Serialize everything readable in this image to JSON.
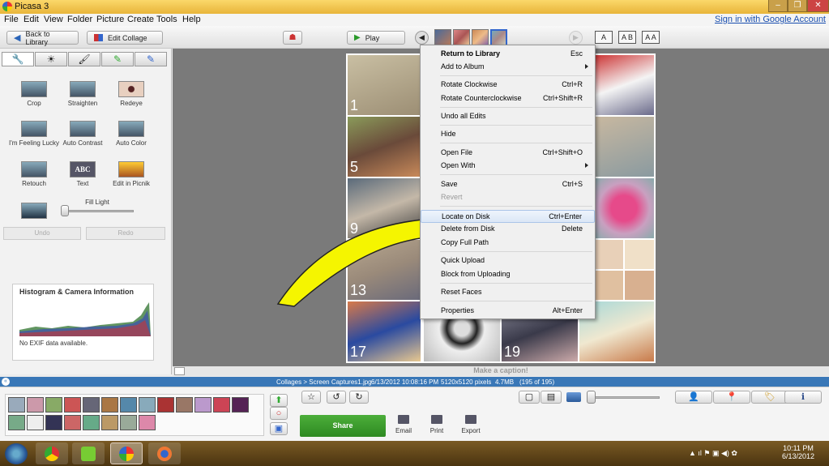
{
  "window": {
    "title": "Picasa 3"
  },
  "menu": {
    "items": [
      "File",
      "Edit",
      "View",
      "Folder",
      "Picture",
      "Create",
      "Tools",
      "Help"
    ],
    "signin": "Sign in with Google Account"
  },
  "toolbar": {
    "back_label": "Back to Library",
    "edit_collage_label": "Edit Collage",
    "play_label": "Play",
    "text_sizes": [
      "A",
      "A B",
      "A A"
    ]
  },
  "left_panel": {
    "tools": [
      {
        "label": "Crop"
      },
      {
        "label": "Straighten"
      },
      {
        "label": "Redeye"
      },
      {
        "label": "I'm Feeling Lucky"
      },
      {
        "label": "Auto Contrast"
      },
      {
        "label": "Auto Color"
      },
      {
        "label": "Retouch"
      },
      {
        "label": "Text"
      },
      {
        "label": "Edit in Picnik"
      }
    ],
    "fill_light_label": "Fill Light",
    "undo_label": "Undo",
    "redo_label": "Redo",
    "histogram_title": "Histogram & Camera Information",
    "exif_text": "No EXIF data available."
  },
  "collage": {
    "numbers": [
      "1",
      "5",
      "9",
      "13",
      "17",
      "19"
    ]
  },
  "caption": {
    "placeholder": "Make a caption!"
  },
  "status": {
    "path": "Collages > Screen Captures1.jpg",
    "datetime": "6/13/2012 10:08:16 PM",
    "dimensions": "5120x5120 pixels",
    "size": "4.7MB",
    "count": "(195 of 195)"
  },
  "context_menu": {
    "items": [
      {
        "label": "Return to Library",
        "accel": "Esc"
      },
      {
        "label": "Add to Album",
        "accel": ""
      },
      {
        "label": "Rotate Clockwise",
        "accel": "Ctrl+R"
      },
      {
        "label": "Rotate Counterclockwise",
        "accel": "Ctrl+Shift+R"
      },
      {
        "label": "Undo all Edits",
        "accel": ""
      },
      {
        "label": "Hide",
        "accel": ""
      },
      {
        "label": "Open File",
        "accel": "Ctrl+Shift+O"
      },
      {
        "label": "Open With",
        "accel": ""
      },
      {
        "label": "Save",
        "accel": "Ctrl+S"
      },
      {
        "label": "Revert",
        "accel": ""
      },
      {
        "label": "Locate on Disk",
        "accel": "Ctrl+Enter"
      },
      {
        "label": "Delete from Disk",
        "accel": "Delete"
      },
      {
        "label": "Copy Full Path",
        "accel": ""
      },
      {
        "label": "Quick Upload",
        "accel": ""
      },
      {
        "label": "Block from Uploading",
        "accel": ""
      },
      {
        "label": "Reset Faces",
        "accel": ""
      },
      {
        "label": "Properties",
        "accel": "Alt+Enter"
      }
    ]
  },
  "bottom": {
    "share_label": "Share",
    "email_label": "Email",
    "print_label": "Print",
    "export_label": "Export"
  },
  "taskbar": {
    "time": "10:11 PM",
    "date": "6/13/2012"
  },
  "colors": {
    "accent": "#3977b7",
    "share_green": "#3a9c2c",
    "title_bar": "#f3c650",
    "arrow_yellow": "#f5f500"
  }
}
